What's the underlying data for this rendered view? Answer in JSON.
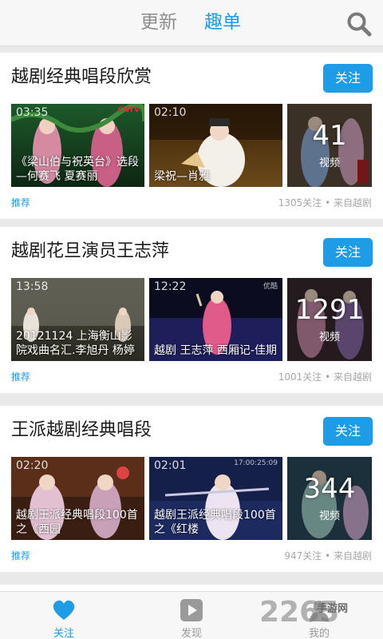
{
  "header": {
    "tabs": [
      {
        "label": "更新",
        "active": false
      },
      {
        "label": "趣单",
        "active": true
      }
    ]
  },
  "colors": {
    "accent": "#1f9ce6",
    "inactive_tab": "#8d8d8d",
    "meta_text": "#a8a8a8"
  },
  "cards": [
    {
      "title": "越剧经典唱段欣赏",
      "follow_label": "关注",
      "videos": [
        {
          "duration": "03:35",
          "caption": "《梁山伯与祝英台》选段—何赛飞 夏赛丽",
          "watermark": "CNTV"
        },
        {
          "duration": "02:10",
          "caption": "梁祝—肖雅"
        }
      ],
      "count": "41",
      "count_unit": "视频",
      "tag": "推荐",
      "meta": "1305关注 • 来自越剧"
    },
    {
      "title": "越剧花旦演员王志萍",
      "follow_label": "关注",
      "videos": [
        {
          "duration": "13:58",
          "caption": "20121124 上海衡山影院戏曲名汇.李旭丹 杨婷"
        },
        {
          "duration": "12:22",
          "caption": "越剧 王志萍 西厢记-佳期",
          "watermark": "优酷"
        }
      ],
      "count": "1291",
      "count_unit": "视频",
      "tag": "推荐",
      "meta": "1001关注 • 来自越剧"
    },
    {
      "title": "王派越剧经典唱段",
      "follow_label": "关注",
      "videos": [
        {
          "duration": "02:20",
          "caption": "越剧王派经典唱段100首之《西园"
        },
        {
          "duration": "02:01",
          "caption": "越剧王派经典唱段100首之《红楼",
          "watermark": "17:00:25:09"
        }
      ],
      "count": "344",
      "count_unit": "视频",
      "tag": "推荐",
      "meta": "947关注 • 来自越剧"
    }
  ],
  "bottom_nav": [
    {
      "label": "关注",
      "icon": "heart-icon",
      "active": true
    },
    {
      "label": "发现",
      "icon": "play-icon",
      "active": false
    },
    {
      "label": "我的",
      "icon": "person-icon",
      "active": false
    }
  ],
  "watermark": {
    "digits": "2265",
    "text": "手游网"
  }
}
